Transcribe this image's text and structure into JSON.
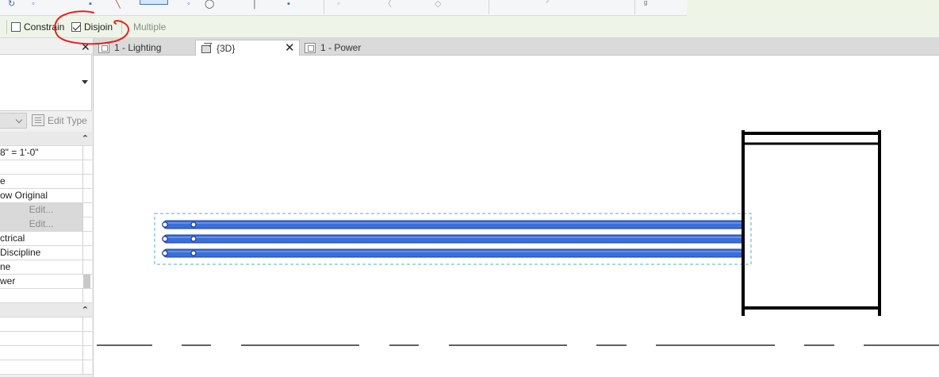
{
  "options_bar": {
    "constrain_label": "Constrain",
    "disjoin_label": "Disjoin",
    "multiple_label": "Multiple",
    "constrain_checked": false,
    "disjoin_checked": true
  },
  "properties": {
    "edit_type_label": "Edit Type",
    "rows": [
      {
        "text": "8\" = 1'-0\"",
        "kind": "value"
      },
      {
        "text": "",
        "kind": "value"
      },
      {
        "text": "e",
        "kind": "value"
      },
      {
        "text": "ow Original",
        "kind": "value"
      },
      {
        "text": "Edit...",
        "kind": "button"
      },
      {
        "text": "Edit...",
        "kind": "button"
      },
      {
        "text": "ctrical",
        "kind": "value"
      },
      {
        "text": "Discipline",
        "kind": "value"
      },
      {
        "text": "ne",
        "kind": "value"
      },
      {
        "text": "wer",
        "kind": "value"
      },
      {
        "text": "",
        "kind": "value"
      }
    ]
  },
  "tabs": [
    {
      "label": "1 - Lighting",
      "active": false
    },
    {
      "label": "{3D}",
      "active": true
    },
    {
      "label": "1 - Power",
      "active": false
    }
  ],
  "colors": {
    "conduit_blue": "#3a6fd8",
    "conduit_dark": "#1f3fa0",
    "selection_dash": "#5aa8d8",
    "annotation_red": "#e8201c",
    "options_bg": "#eef4e7"
  },
  "icons": {
    "close": "close-icon",
    "view_3d": "cube-3d-icon",
    "floor_plan": "floor-plan-icon",
    "edit_type": "edit-type-icon"
  }
}
